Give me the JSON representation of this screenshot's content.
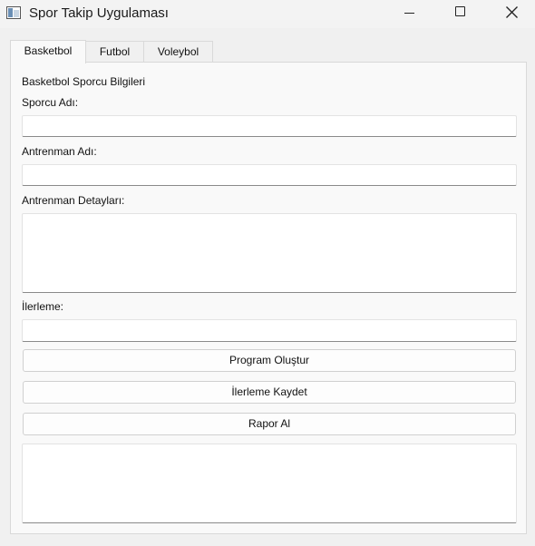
{
  "window": {
    "title": "Spor Takip Uygulaması",
    "controls": {
      "minimize": "minimize-icon",
      "maximize": "maximize-icon",
      "close": "close-icon"
    }
  },
  "tabs": [
    {
      "label": "Basketbol",
      "selected": true
    },
    {
      "label": "Futbol",
      "selected": false
    },
    {
      "label": "Voleybol",
      "selected": false
    }
  ],
  "form": {
    "section_title": "Basketbol Sporcu Bilgileri",
    "athlete_name_label": "Sporcu Adı:",
    "athlete_name_value": "",
    "training_name_label": "Antrenman Adı:",
    "training_name_value": "",
    "training_details_label": "Antrenman Detayları:",
    "training_details_value": "",
    "progress_label": "İlerleme:",
    "progress_value": "",
    "output_value": ""
  },
  "buttons": {
    "create_program": "Program Oluştur",
    "save_progress": "İlerleme Kaydet",
    "get_report": "Rapor Al"
  }
}
